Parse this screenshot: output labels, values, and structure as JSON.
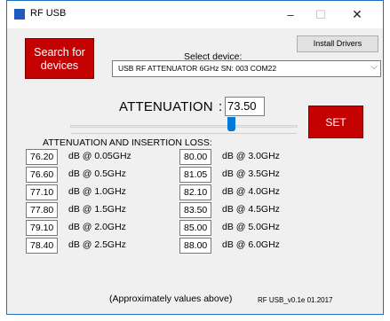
{
  "window": {
    "title": "RF USB",
    "min_glyph": "–",
    "max_glyph": "☐",
    "close_glyph": "✕"
  },
  "controls": {
    "search_button": "Search for devices",
    "install_button": "Install Drivers",
    "select_label": "Select device:",
    "device_value": "USB RF ATTENUATOR 6GHz SN: 003    COM22",
    "dropdown_glyph": "⌵",
    "attenuation_label": "ATTENUATION",
    "attenuation_colon": ":",
    "attenuation_value": "73.50",
    "slider_value_db": 73.5,
    "set_button": "SET"
  },
  "loss_section": {
    "title": "ATTENUATION AND INSERTION LOSS:",
    "left": [
      {
        "value": "76.20",
        "unit": "dB @ 0.05GHz"
      },
      {
        "value": "76.60",
        "unit": "dB @ 0.5GHz"
      },
      {
        "value": "77.10",
        "unit": "dB @ 1.0GHz"
      },
      {
        "value": "77.80",
        "unit": "dB @ 1.5GHz"
      },
      {
        "value": "79.10",
        "unit": "dB @ 2.0GHz"
      },
      {
        "value": "78.40",
        "unit": "dB @ 2.5GHz"
      }
    ],
    "right": [
      {
        "value": "80.00",
        "unit": "dB @ 3.0GHz"
      },
      {
        "value": "81.05",
        "unit": "dB @ 3.5GHz"
      },
      {
        "value": "82.10",
        "unit": "dB @ 4.0GHz"
      },
      {
        "value": "83.50",
        "unit": "dB @ 4.5GHz"
      },
      {
        "value": "85.00",
        "unit": "dB @ 5.0GHz"
      },
      {
        "value": "88.00",
        "unit": "dB @ 6.0GHz"
      }
    ]
  },
  "footer": {
    "note": "(Approximately values above)",
    "version": "RF USB_v0.1e 01.2017"
  },
  "colors": {
    "accent_red": "#c40000",
    "slider_blue": "#0078d7",
    "window_bg": "#f0f0f0"
  },
  "icons": {
    "app": "app-icon",
    "minimize": "minimize-icon",
    "maximize": "maximize-icon",
    "close": "close-icon",
    "dropdown": "chevron-down-icon"
  }
}
